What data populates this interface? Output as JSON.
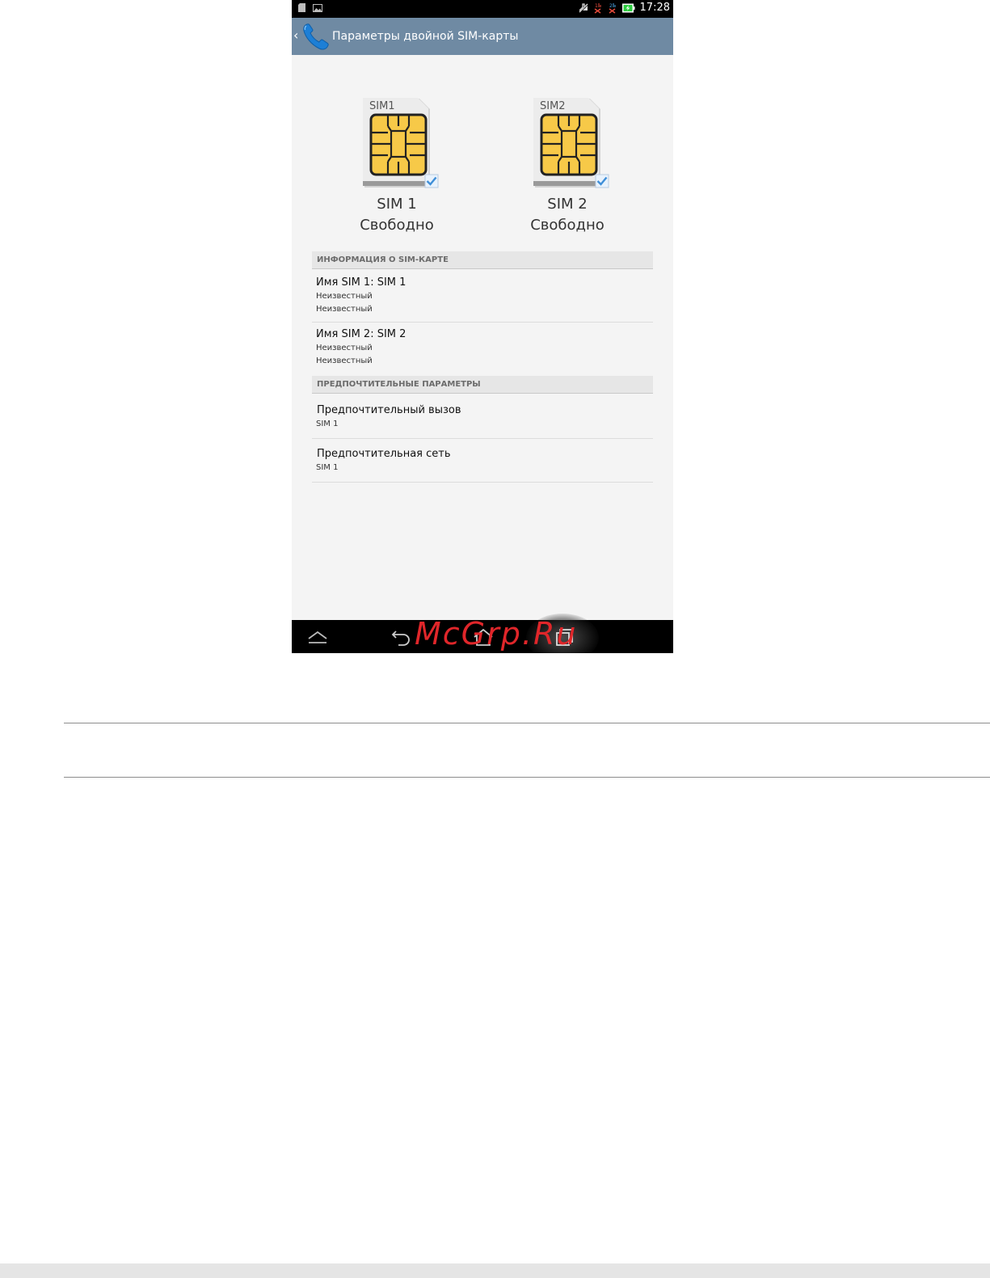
{
  "status_bar": {
    "time": "17:28",
    "icons": [
      "sd-card-icon",
      "image-icon",
      "mute-icon",
      "no-signal-sim1-icon",
      "no-signal-sim2-icon",
      "battery-charging-icon"
    ]
  },
  "action_bar": {
    "back_glyph": "‹",
    "app_icon": "phone-icon",
    "title": "Параметры двойной SIM-карты"
  },
  "sim_cards": [
    {
      "card_label": "SIM1",
      "name": "SIM 1",
      "status": "Свободно",
      "checked": true
    },
    {
      "card_label": "SIM2",
      "name": "SIM 2",
      "status": "Свободно",
      "checked": true
    }
  ],
  "sim_info": {
    "header": "ИНФОРМАЦИЯ О SIM-КАРТЕ",
    "items": [
      {
        "title": "Имя SIM 1: SIM 1",
        "line1": "Неизвестный",
        "line2": "Неизвестный"
      },
      {
        "title": "Имя SIM 2: SIM 2",
        "line1": "Неизвестный",
        "line2": "Неизвестный"
      }
    ]
  },
  "preferences": {
    "header": "ПРЕДПОЧТИТЕЛЬНЫЕ ПАРАМЕТРЫ",
    "items": [
      {
        "title": "Предпочтительный вызов",
        "value": "SIM 1"
      },
      {
        "title": "Предпочтительная сеть",
        "value": "SIM 1"
      }
    ]
  },
  "nav_bar": {
    "buttons": [
      "hide-keyboard-icon",
      "back-icon",
      "home-icon",
      "recent-apps-icon"
    ]
  },
  "watermark": "McGrp.Ru",
  "colors": {
    "action_bar": "#6f8aa3",
    "sim_chip": "#f7c948",
    "checkmark": "#3f8fd8",
    "watermark": "#e0262a"
  }
}
